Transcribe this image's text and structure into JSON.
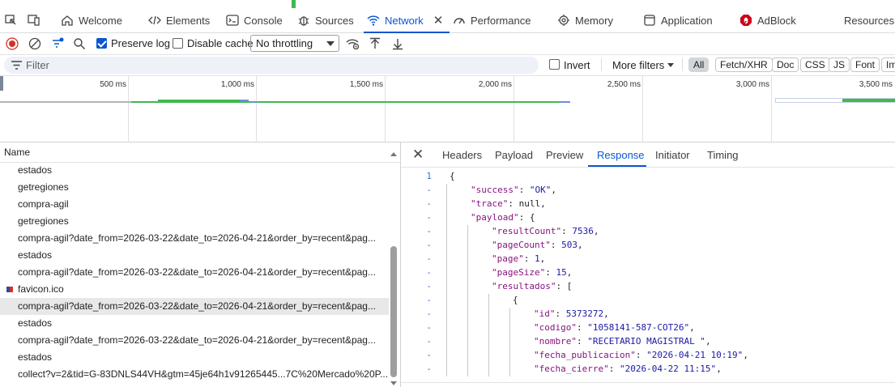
{
  "tabs": [
    {
      "label": "Welcome",
      "icon": "home-icon"
    },
    {
      "label": "Elements",
      "icon": "code-icon"
    },
    {
      "label": "Console",
      "icon": "console-icon"
    },
    {
      "label": "Sources",
      "icon": "bug-icon"
    },
    {
      "label": "Network",
      "icon": "wifi-icon",
      "active": true
    },
    {
      "label": "Performance",
      "icon": "performance-icon"
    },
    {
      "label": "Memory",
      "icon": "memory-icon"
    },
    {
      "label": "Application",
      "icon": "application-icon"
    },
    {
      "label": "AdBlock",
      "icon": "adblock-icon"
    },
    {
      "label": "ResourcesSa",
      "icon": ""
    }
  ],
  "toolbar": {
    "preserve_log": "Preserve log",
    "preserve_log_checked": true,
    "disable_cache": "Disable cache",
    "disable_cache_checked": false,
    "throttling": "No throttling"
  },
  "filter": {
    "placeholder": "Filter",
    "invert": "Invert",
    "more_filters": "More filters",
    "types": [
      "All",
      "Fetch/XHR",
      "Doc",
      "CSS",
      "JS",
      "Font",
      "Im"
    ]
  },
  "overview": {
    "ticks": [
      "500 ms",
      "1,000 ms",
      "1,500 ms",
      "2,000 ms",
      "2,500 ms",
      "3,000 ms",
      "3,500 ms"
    ]
  },
  "requests": {
    "header": "Name",
    "rows": [
      "estados",
      "getregiones",
      "compra-agil",
      "getregiones",
      "compra-agil?date_from=2026-03-22&date_to=2026-04-21&order_by=recent&pag...",
      "estados",
      "compra-agil?date_from=2026-03-22&date_to=2026-04-21&order_by=recent&pag...",
      "favicon.ico",
      "compra-agil?date_from=2026-03-22&date_to=2026-04-21&order_by=recent&pag...",
      "estados",
      "compra-agil?date_from=2026-03-22&date_to=2026-04-21&order_by=recent&pag...",
      "estados",
      "collect?v=2&tid=G-83DNLS44VH&gtm=45je64h1v91265445...7C%20Mercado%20P..."
    ],
    "selected_index": 8,
    "favicon_index": 7
  },
  "detail": {
    "tabs": [
      "Headers",
      "Payload",
      "Preview",
      "Response",
      "Initiator",
      "Timing"
    ],
    "active": "Response"
  },
  "response_lines": [
    {
      "g": "1",
      "indent": 0,
      "parts": [
        [
          "p",
          "{"
        ]
      ]
    },
    {
      "g": "-",
      "indent": 1,
      "parts": [
        [
          "s",
          "\"success\""
        ],
        [
          "p",
          ": "
        ],
        [
          "s",
          "\"OK\""
        ],
        [
          "p",
          ","
        ]
      ]
    },
    {
      "g": "-",
      "indent": 1,
      "parts": [
        [
          "s",
          "\"trace\""
        ],
        [
          "p",
          ": null,"
        ]
      ]
    },
    {
      "g": "-",
      "indent": 1,
      "parts": [
        [
          "s",
          "\"payload\""
        ],
        [
          "p",
          ": {"
        ]
      ]
    },
    {
      "g": "-",
      "indent": 2,
      "parts": [
        [
          "s",
          "\"resultCount\""
        ],
        [
          "p",
          ": "
        ],
        [
          "n",
          "7536"
        ],
        [
          "p",
          ","
        ]
      ]
    },
    {
      "g": "-",
      "indent": 2,
      "parts": [
        [
          "s",
          "\"pageCount\""
        ],
        [
          "p",
          ": "
        ],
        [
          "n",
          "503"
        ],
        [
          "p",
          ","
        ]
      ]
    },
    {
      "g": "-",
      "indent": 2,
      "parts": [
        [
          "s",
          "\"page\""
        ],
        [
          "p",
          ": "
        ],
        [
          "n",
          "1"
        ],
        [
          "p",
          ","
        ]
      ]
    },
    {
      "g": "-",
      "indent": 2,
      "parts": [
        [
          "s",
          "\"pageSize\""
        ],
        [
          "p",
          ": "
        ],
        [
          "n",
          "15"
        ],
        [
          "p",
          ","
        ]
      ]
    },
    {
      "g": "-",
      "indent": 2,
      "parts": [
        [
          "s",
          "\"resultados\""
        ],
        [
          "p",
          ": ["
        ]
      ]
    },
    {
      "g": "-",
      "indent": 3,
      "parts": [
        [
          "p",
          "{"
        ]
      ]
    },
    {
      "g": "-",
      "indent": 4,
      "parts": [
        [
          "s",
          "\"id\""
        ],
        [
          "p",
          ": "
        ],
        [
          "n",
          "5373272"
        ],
        [
          "p",
          ","
        ]
      ]
    },
    {
      "g": "-",
      "indent": 4,
      "parts": [
        [
          "s",
          "\"codigo\""
        ],
        [
          "p",
          ": "
        ],
        [
          "s",
          "\"1058141-587-COT26\""
        ],
        [
          "p",
          ","
        ]
      ]
    },
    {
      "g": "-",
      "indent": 4,
      "parts": [
        [
          "s",
          "\"nombre\""
        ],
        [
          "p",
          ": "
        ],
        [
          "s",
          "\"RECETARIO MAGISTRAL \""
        ],
        [
          "p",
          ","
        ]
      ]
    },
    {
      "g": "-",
      "indent": 4,
      "parts": [
        [
          "s",
          "\"fecha_publicacion\""
        ],
        [
          "p",
          ": "
        ],
        [
          "s",
          "\"2026-04-21 10:19\""
        ],
        [
          "p",
          ","
        ]
      ]
    },
    {
      "g": "-",
      "indent": 4,
      "parts": [
        [
          "s",
          "\"fecha_cierre\""
        ],
        [
          "p",
          ": "
        ],
        [
          "s",
          "\"2026-04-22 11:15\""
        ],
        [
          "p",
          ","
        ]
      ]
    }
  ],
  "colors": {
    "accent": "#0b57d0",
    "record": "#d93025",
    "timeline_green": "#3fb950",
    "timeline_blue": "#6b8fd6"
  }
}
